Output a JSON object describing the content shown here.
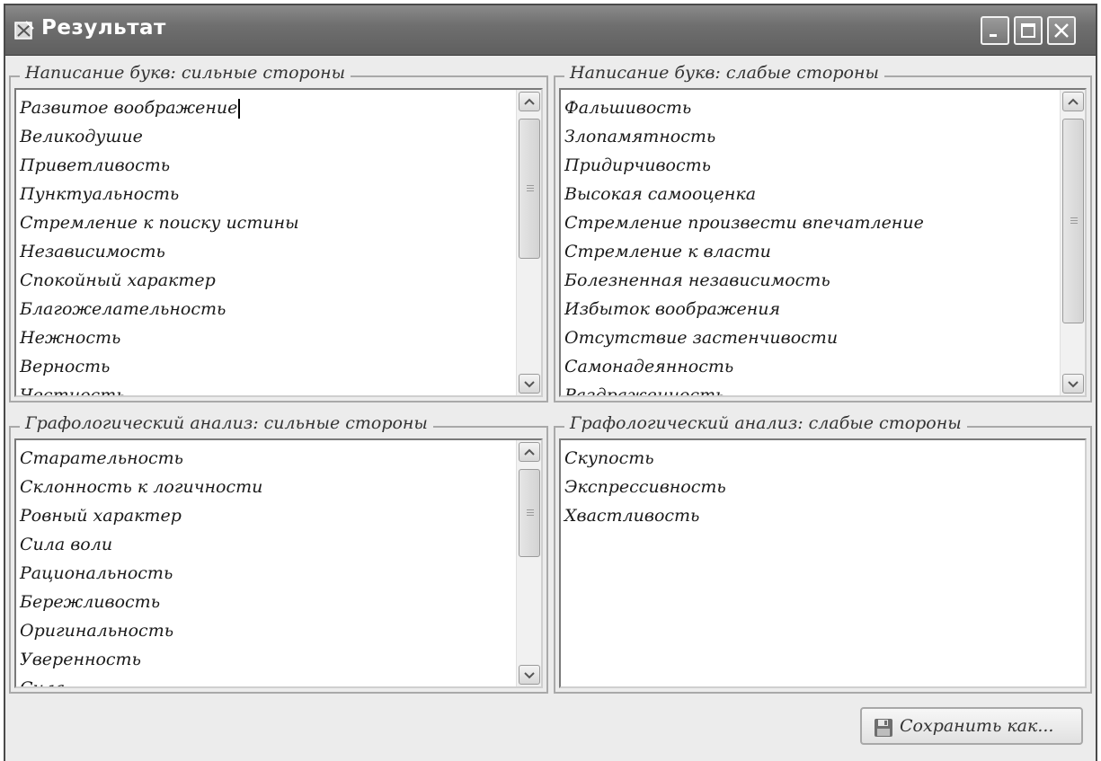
{
  "window": {
    "title": "Результат"
  },
  "panels": {
    "writing_strong": {
      "title": "Написание букв: сильные стороны",
      "items": [
        "Развитое воображение",
        "Великодушие",
        "Приветливость",
        "Пунктуальность",
        "Стремление к поиску истины",
        "Независимость",
        "Спокойный характер",
        "Благожелательность",
        "Нежность",
        "Верность",
        "Честность"
      ]
    },
    "writing_weak": {
      "title": "Написание букв: слабые стороны",
      "items": [
        "Фальшивость",
        "Злопамятность",
        "Придирчивость",
        "Высокая самооценка",
        "Стремление произвести впечатление",
        "Стремление к власти",
        "Болезненная независимость",
        "Избыток воображения",
        "Отсутствие застенчивости",
        "Самонадеянность",
        "Раздраженность"
      ]
    },
    "grapho_strong": {
      "title": "Графологический анализ: сильные стороны",
      "items": [
        "Старательность",
        "Склонность к логичности",
        "Ровный характер",
        "Сила воли",
        "Рациональность",
        "Бережливость",
        "Оригинальность",
        "Уверенность",
        "Сила"
      ]
    },
    "grapho_weak": {
      "title": "Графологический анализ: слабые стороны",
      "items": [
        "Скупость",
        "Экспрессивность",
        "Хвастливость"
      ]
    }
  },
  "footer": {
    "save_label": "Сохранить как..."
  },
  "icons": {
    "title": "app-icon",
    "save": "floppy-disk-icon"
  }
}
